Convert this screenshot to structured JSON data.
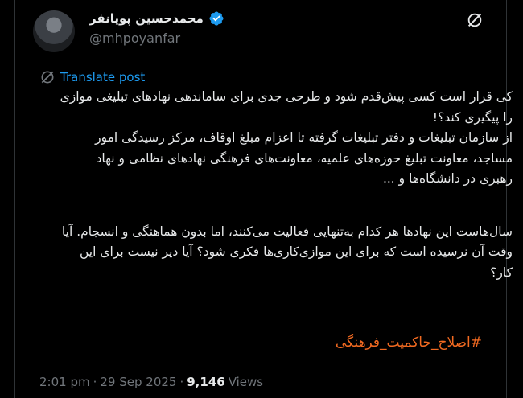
{
  "author": {
    "name": "محمدحسین پویانفر",
    "handle": "@mhpoyanfar"
  },
  "translate_label": "Translate post",
  "body_lines": [
    "کی قرار است کسی پیش‌قدم شود و طرحی جدی برای ساماندهی نهادهای تبلیغی موازی",
    "را پیگیری کند؟!",
    "از سازمان تبلیغات و دفتر تبلیغات گرفته تا اعزام مبلغ اوقاف، مرکز رسیدگی امور",
    "مساجد، معاونت تبلیغ حوزه‌های علمیه، معاونت‌های فرهنگی نهادهای نظامی و نهاد",
    "رهبری در دانشگاه‌ها و ..."
  ],
  "body_lines_2": [
    "سال‌هاست این نهادها هر کدام به‌تنهایی فعالیت می‌کنند، اما بدون هماهنگی و انسجام. آیا",
    "وقت آن نرسیده است که برای این موازی‌کاری‌ها فکری شود؟ آیا دیر نیست برای این",
    "کار؟"
  ],
  "hashtag": "#اصلاح_حاکمیت_فرهنگی",
  "meta": {
    "time": "2:01 pm",
    "sep1": "·",
    "date": "29 Sep 2025",
    "sep2": "·",
    "views_count": "9,146",
    "views_label": "Views"
  },
  "colors": {
    "background": "#000000",
    "text": "#e7e9ea",
    "muted": "#71767b",
    "link": "#1d9bf0",
    "hashtag": "#f26a21",
    "verified": "#1d9bf0"
  },
  "icons": [
    "verified-badge-icon",
    "grok-icon",
    "translate-icon"
  ]
}
